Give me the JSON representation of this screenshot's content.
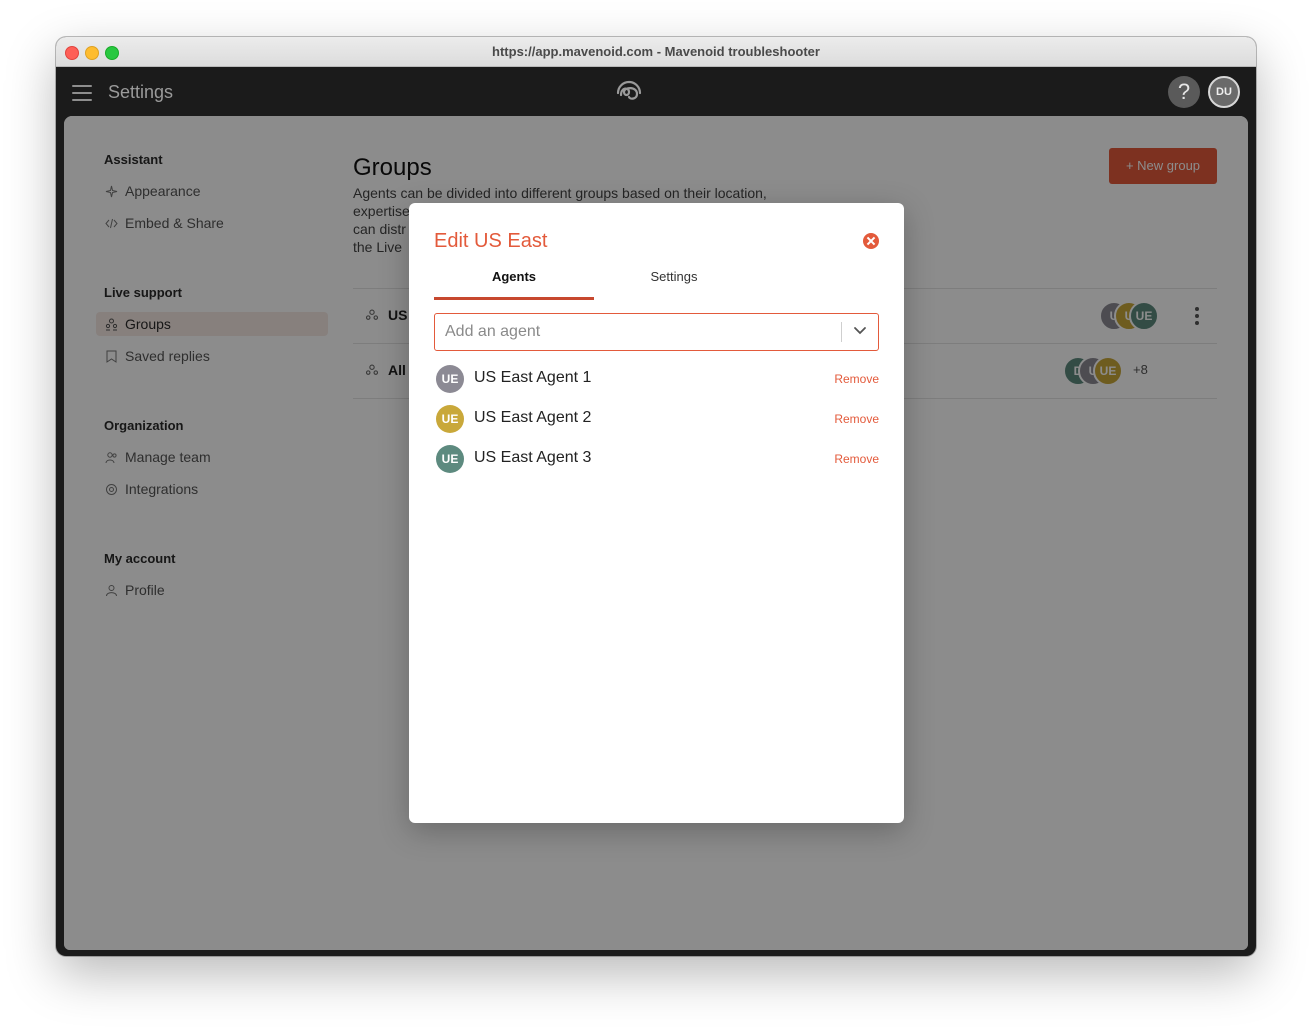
{
  "window": {
    "title": "https://app.mavenoid.com - Mavenoid troubleshooter"
  },
  "appbar": {
    "title": "Settings",
    "help_label": "?",
    "user_initials": "DU"
  },
  "sidebar": {
    "sections": [
      {
        "title": "Assistant",
        "items": [
          {
            "label": "Appearance",
            "icon": "sparkle-icon"
          },
          {
            "label": "Embed & Share",
            "icon": "code-icon"
          }
        ]
      },
      {
        "title": "Live support",
        "items": [
          {
            "label": "Groups",
            "icon": "groups-icon",
            "active": true
          },
          {
            "label": "Saved replies",
            "icon": "bookmark-icon"
          }
        ]
      },
      {
        "title": "Organization",
        "items": [
          {
            "label": "Manage team",
            "icon": "team-icon"
          },
          {
            "label": "Integrations",
            "icon": "integrations-icon"
          }
        ]
      },
      {
        "title": "My account",
        "items": [
          {
            "label": "Profile",
            "icon": "person-icon"
          }
        ]
      }
    ]
  },
  "main": {
    "title": "Groups",
    "description_lines": [
      "Agents can be divided into different groups based on their location,",
      "expertise",
      "can distr",
      "the Live "
    ],
    "new_group_label": "+ New group",
    "groups": [
      {
        "name": "US",
        "avatars": [
          "U",
          "U",
          "UE"
        ],
        "avatar_colors": [
          "#8c8a94",
          "#c9a83a",
          "#5d8a7f"
        ]
      },
      {
        "name": "All",
        "avatars": [
          "D",
          "U",
          "UE"
        ],
        "avatar_colors": [
          "#5d8a7f",
          "#8c8a94",
          "#c9a83a"
        ],
        "more": "+8"
      }
    ]
  },
  "modal": {
    "title": "Edit US East",
    "tabs": [
      {
        "label": "Agents",
        "active": true
      },
      {
        "label": "Settings",
        "active": false
      }
    ],
    "add_agent_placeholder": "Add an agent",
    "remove_label": "Remove",
    "agents": [
      {
        "initials": "UE",
        "name": "US East Agent 1",
        "color": "#8c8a94"
      },
      {
        "initials": "UE",
        "name": "US East Agent 2",
        "color": "#c9a83a"
      },
      {
        "initials": "UE",
        "name": "US East Agent 3",
        "color": "#5d8a7f"
      }
    ]
  },
  "colors": {
    "accent": "#e35a3b",
    "appbar": "#1b1b1b"
  }
}
